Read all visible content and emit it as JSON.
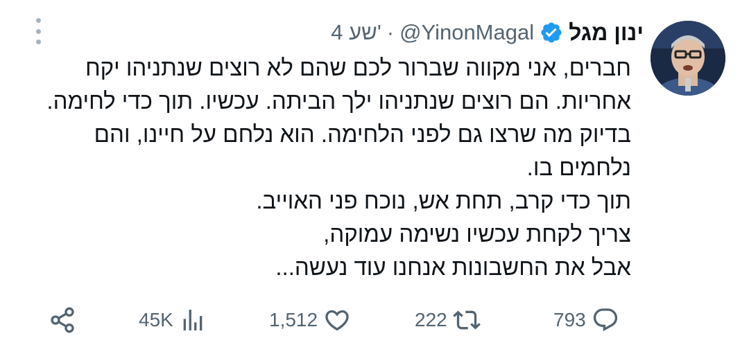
{
  "author": {
    "display_name": "ינון מגל",
    "handle": "@YinonMagal",
    "separator": "·",
    "time_ago": "4 שע'",
    "verified_color": "#1d9bf0"
  },
  "body": {
    "lines": [
      "חברים, אני מקווה שברור לכם שהם לא רוצים שנתניהו יקח",
      "אחריות. הם רוצים שנתניהו ילך הביתה. עכשיו. תוך כדי לחימה.",
      "בדיוק מה שרצו גם לפני הלחימה. הוא נלחם על חיינו, והם",
      "נלחמים בו.",
      "תוך כדי קרב, תחת אש, נוכח פני האוייב.",
      "צריך לקחת עכשיו נשימה עמוקה,",
      "אבל את החשבונות אנחנו עוד נעשה..."
    ]
  },
  "actions": {
    "replies": "793",
    "retweets": "222",
    "likes": "1,512",
    "views": "45K"
  },
  "icons": {
    "more": "more-vertical-icon",
    "verified": "verified-badge-icon",
    "reply": "reply-icon",
    "retweet": "retweet-icon",
    "like": "heart-icon",
    "views": "views-chart-icon",
    "share": "share-icon"
  },
  "colors": {
    "text": "#0f1419",
    "secondary": "#536471",
    "accent": "#1d9bf0"
  }
}
